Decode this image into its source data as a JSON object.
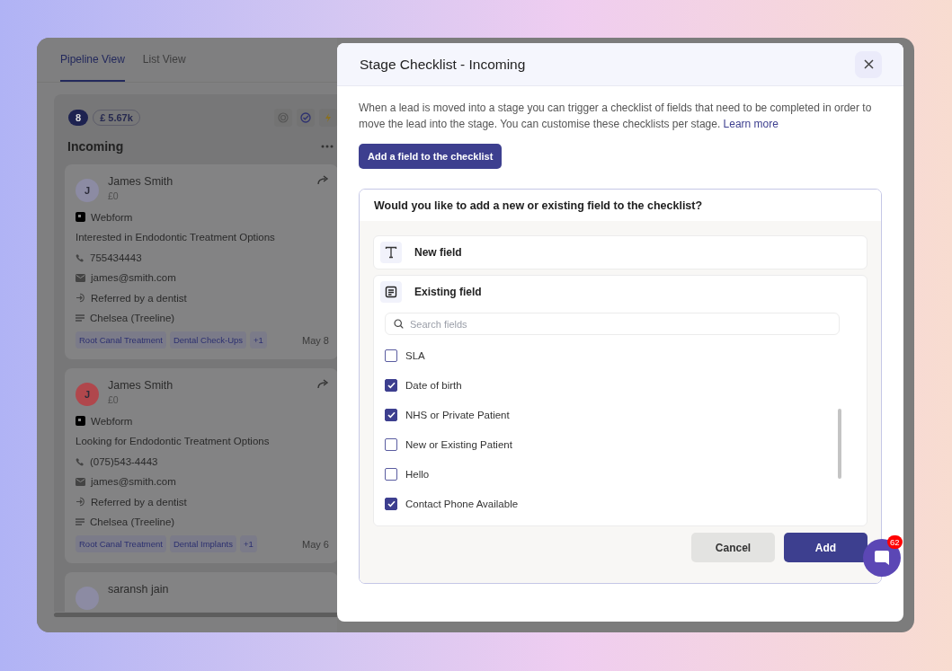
{
  "tabs": [
    {
      "label": "Pipeline View",
      "selected": true
    },
    {
      "label": "List View",
      "selected": false
    }
  ],
  "column": {
    "count": "8",
    "value": "£ 5.67k",
    "title": "Incoming",
    "cards": [
      {
        "initial": "J",
        "color": "#8c8ba3",
        "name": "James Smith",
        "amount": "£0",
        "source": "Webform",
        "note": "Interested in Endodontic Treatment Options",
        "phone": "755434443",
        "email": "james@smith.com",
        "referral": "Referred by a dentist",
        "location": "Chelsea (Treeline)",
        "tags": [
          "Root Canal Treatment",
          "Dental Check-Ups"
        ],
        "more_tags": "+1",
        "date": "May 8"
      },
      {
        "initial": "J",
        "color": "#b0474c",
        "name": "James Smith",
        "amount": "£0",
        "source": "Webform",
        "note": "Looking for Endodontic Treatment Options",
        "phone": "(075)543-4443",
        "email": "james@smith.com",
        "referral": "Referred by a dentist",
        "location": "Chelsea (Treeline)",
        "tags": [
          "Root Canal Treatment",
          "Dental Implants"
        ],
        "more_tags": "+1",
        "date": "May 6"
      },
      {
        "color": "#8c8ba3",
        "name": "saransh jain"
      }
    ]
  },
  "modal": {
    "title": "Stage Checklist - Incoming",
    "description": "When a lead is moved into a stage you can trigger a checklist of fields that need to be completed in order to move the lead into the stage. You can customise these checklists per stage.",
    "link": "Learn more",
    "add_field_button": "Add a field to the checklist",
    "question": "Would you like to add a new or existing field to the checklist?",
    "options": [
      {
        "kind": "new",
        "label": "New field"
      },
      {
        "kind": "existing",
        "label": "Existing field"
      }
    ],
    "search": {
      "placeholder": "Search fields"
    },
    "fields": [
      {
        "label": "SLA",
        "checked": false
      },
      {
        "label": "Date of birth",
        "checked": true
      },
      {
        "label": "NHS or Private Patient",
        "checked": true
      },
      {
        "label": "New or Existing Patient",
        "checked": false
      },
      {
        "label": "Hello",
        "checked": false
      },
      {
        "label": "Contact Phone Available",
        "checked": true
      }
    ],
    "buttons": {
      "cancel": "Cancel",
      "add": "Add"
    }
  },
  "chat": {
    "badge": "62"
  }
}
